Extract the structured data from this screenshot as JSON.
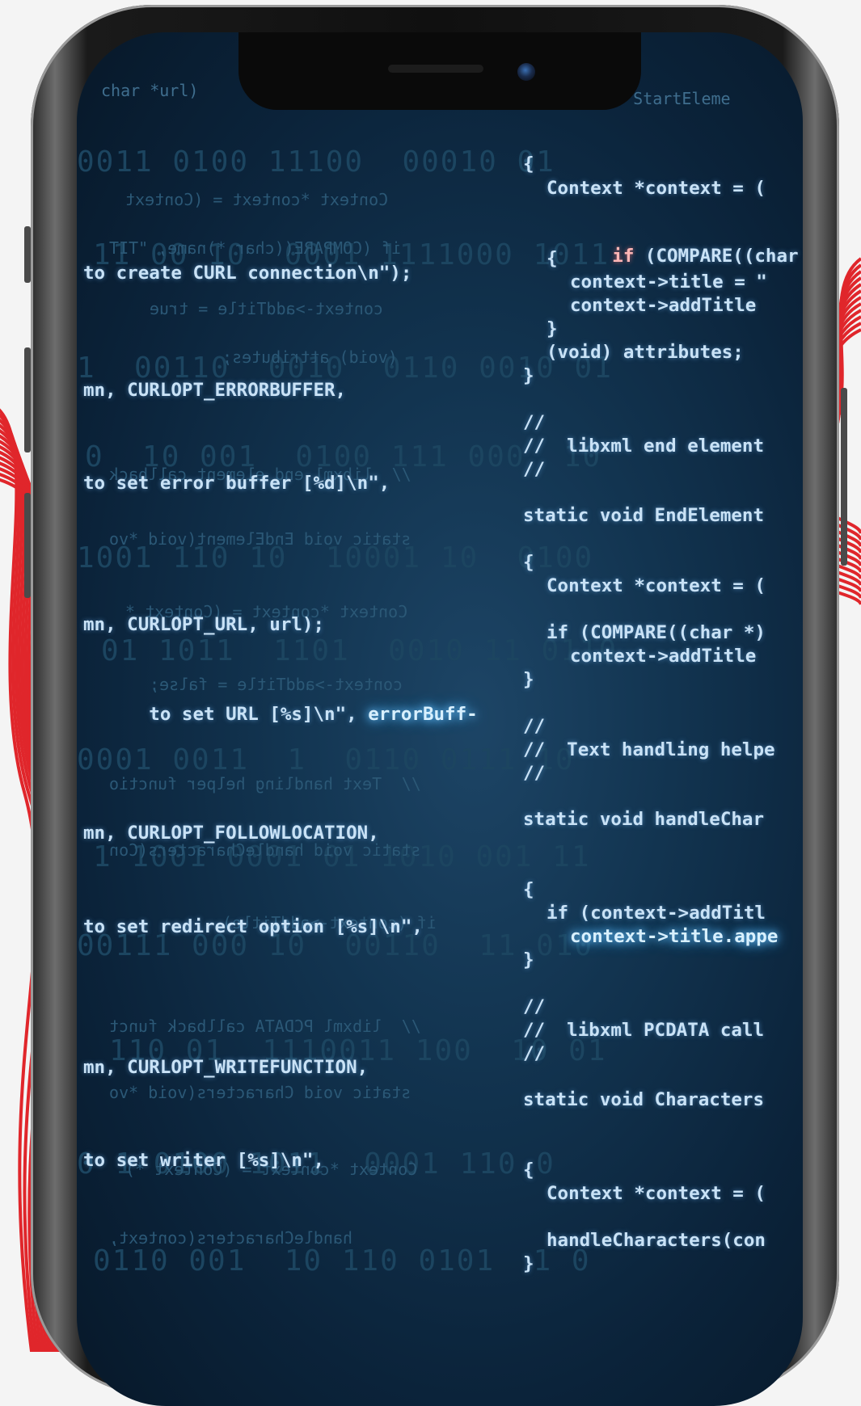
{
  "left_code_lines": [
    "to create CURL connection\\n\");",
    "mn, CURLOPT_ERRORBUFFER,",
    "to set error buffer [%d]\\n\",",
    "mn, CURLOPT_URL, url);",
    "to set URL [%s]\\n\", ",
    "errorBuff-",
    "mn, CURLOPT_FOLLOWLOCATION,",
    "to set redirect option [%s]\\n\",",
    "mn, CURLOPT_WRITEFUNCTION,",
    "to set writer [%s]\\n\","
  ],
  "right_code_lines": [
    "{",
    "Context *context = (",
    "if",
    " (COMPARE((char *)",
    "{",
    "context->title = \"",
    "context->addTitle",
    "}",
    "(void) attributes;",
    "}",
    "//",
    "//  libxml end element",
    "//",
    "static void EndElement",
    "{",
    "Context *context = (",
    "if (COMPARE((char *)",
    "context->addTitle",
    "}",
    "//",
    "//  Text handling helpe",
    "//",
    "static void handleChar",
    "{",
    "if (context->addTitl",
    "context->title.appe",
    "}",
    "//",
    "//  libxml PCDATA call",
    "//",
    "static void Characters",
    "{",
    "Context *context = (",
    "handleCharacters(con",
    "}"
  ],
  "background_fragments": [
    "char *url)",
    "oid StartEleme",
    "Context *context = (Context",
    "if (COMPARE((char *)name, \"TIT",
    "context->addTitle = true",
    "(void) attributes;",
    "//  libxml end element callback",
    "static void EndElement(void *vo",
    "Context *context = (Context *",
    "context->addTitle = false;",
    "//  Text handling helper functio",
    "static void handleCharacters(Con",
    "if (context->addTitle)",
    "//  libxml PCDATA callback funct",
    "static void Characters(void *vo",
    "Context *context = (Context *)",
    "handleCharacters(context,"
  ],
  "binary_rows": [
    "0011 0100 11100  00010 01",
    "11 00 10  0001 1111000 1011",
    "1  00110  0010  0110 0010 01",
    "0  10 001  0100 111 000  10",
    "1001 110 10  10001 10  0100",
    "01 1011  1101  0010 11 0110",
    "0001 0011  1  0110 0111 10",
    "1 1001 0001 01 1010 001 11",
    "00111 000 10  00110  11 010",
    "110 01  1110011 100  10 01",
    "0 1 0100 1011  0001 110 0",
    "0110 001  10 110 0101  1 0"
  ],
  "colors": {
    "screen_bg": "#0b233a",
    "code_text": "#c9e2f6",
    "highlight_glow": "#6fc7ff",
    "keyword_red": "#ffb6b6",
    "decor_red": "#e0262b",
    "page_bg": "#f4f4f4"
  }
}
